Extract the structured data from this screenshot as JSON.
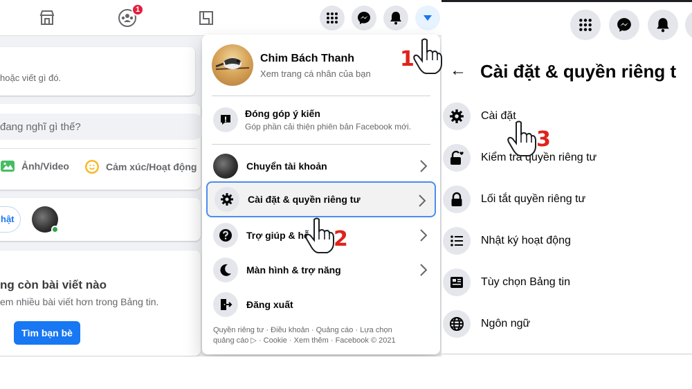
{
  "top_nav": {
    "group_badge": "1"
  },
  "composer": {
    "prompt_short": "hoặc viết gì đó.",
    "prompt": "đang nghĩ gì thế?",
    "photo_label": "Ảnh/Video",
    "feeling_label": "Cảm xúc/Hoạt động"
  },
  "story_chip": "hật",
  "empty_feed": {
    "title": "ng còn bài viết nào",
    "subtitle": "em nhiều bài viết hơn trong Bảng tin.",
    "button": "Tìm bạn bè"
  },
  "account_menu": {
    "profile_name": "Chim Bách Thanh",
    "profile_sub": "Xem trang cá nhân của bạn",
    "feedback_title": "Đóng góp ý kiến",
    "feedback_sub": "Góp phần cải thiện phiên bản Facebook mới.",
    "items": [
      {
        "label": "Chuyển tài khoản",
        "icon": "avatar"
      },
      {
        "label": "Cài đặt & quyền riêng tư",
        "icon": "gear-icon"
      },
      {
        "label": "Trợ giúp & hỗ",
        "icon": "question-icon"
      },
      {
        "label": "Màn hình & trợ năng",
        "icon": "moon-icon"
      },
      {
        "label": "Đăng xuất",
        "icon": "logout-icon"
      }
    ],
    "footer_line1": "Quyền riêng tư · Điều khoản · Quảng cáo · Lựa chọn",
    "footer_line2": "quảng cáo ▷ · Cookie · Xem thêm · Facebook © 2021"
  },
  "settings_panel": {
    "title": "Cài đặt & quyền riêng t",
    "back_icon": "←",
    "items": [
      {
        "label": "Cài đặt",
        "icon": "gear-icon"
      },
      {
        "label": "Kiểm tra quyền riêng tư",
        "icon": "lock-heart-icon"
      },
      {
        "label": "Lối tắt quyền riêng tư",
        "icon": "lock-icon"
      },
      {
        "label": "Nhật ký hoạt động",
        "icon": "list-icon"
      },
      {
        "label": "Tùy chọn Bảng tin",
        "icon": "feed-icon"
      },
      {
        "label": "Ngôn ngữ",
        "icon": "globe-icon"
      }
    ]
  },
  "annotations": {
    "step1": "1",
    "step2": "2",
    "step3": "3"
  },
  "colors": {
    "accent": "#1877f2",
    "annotation": "#e0221b",
    "highlight_border": "#4a8cf0"
  }
}
